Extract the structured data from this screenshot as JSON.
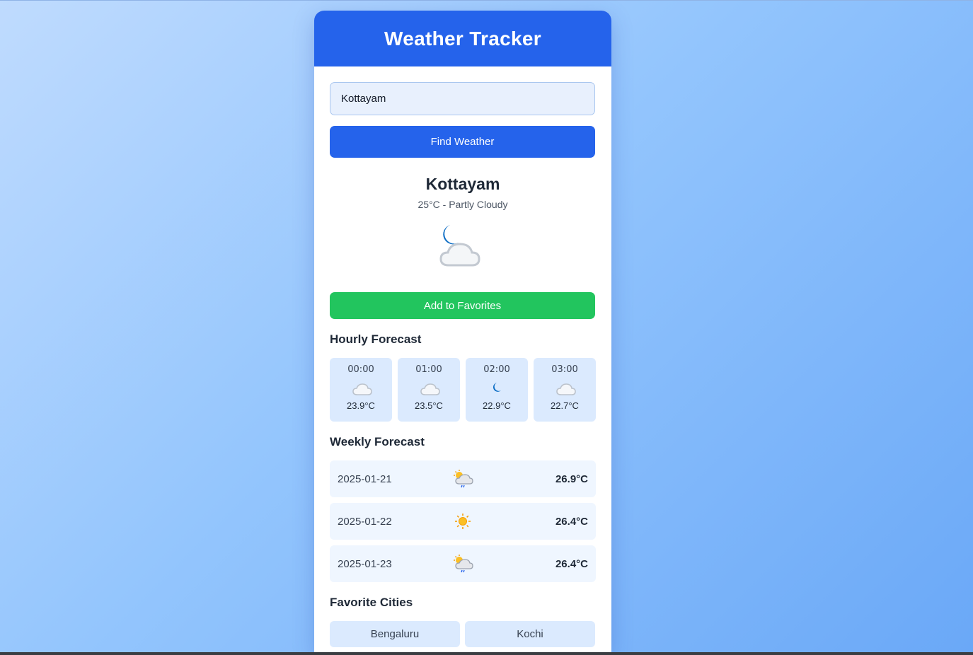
{
  "app": {
    "title": "Weather Tracker"
  },
  "search": {
    "value": "Kottayam",
    "button_label": "Find Weather"
  },
  "current": {
    "city": "Kottayam",
    "summary": "25°C - Partly Cloudy",
    "icon": "partly-cloudy-night-icon",
    "favorite_button_label": "Add to Favorites"
  },
  "hourly": {
    "title": "Hourly Forecast",
    "items": [
      {
        "time": "00:00",
        "icon": "partly-cloudy-night-icon",
        "temp": "23.9°C"
      },
      {
        "time": "01:00",
        "icon": "partly-cloudy-night-icon",
        "temp": "23.5°C"
      },
      {
        "time": "02:00",
        "icon": "clear-night-icon",
        "temp": "22.9°C"
      },
      {
        "time": "03:00",
        "icon": "partly-cloudy-night-icon",
        "temp": "22.7°C"
      }
    ]
  },
  "weekly": {
    "title": "Weekly Forecast",
    "days": [
      {
        "date": "2025-01-21",
        "icon": "sun-cloud-rain-icon",
        "temp": "26.9°C"
      },
      {
        "date": "2025-01-22",
        "icon": "sun-icon",
        "temp": "26.4°C"
      },
      {
        "date": "2025-01-23",
        "icon": "sun-cloud-rain-icon",
        "temp": "26.4°C"
      }
    ]
  },
  "favorites": {
    "title": "Favorite Cities",
    "cities": [
      "Bengaluru",
      "Kochi"
    ]
  },
  "colors": {
    "header": "#2563eb",
    "primary_button": "#2563eb",
    "favorite_button": "#22c55e",
    "tile": "#dbeafe",
    "row": "#eff6ff"
  }
}
